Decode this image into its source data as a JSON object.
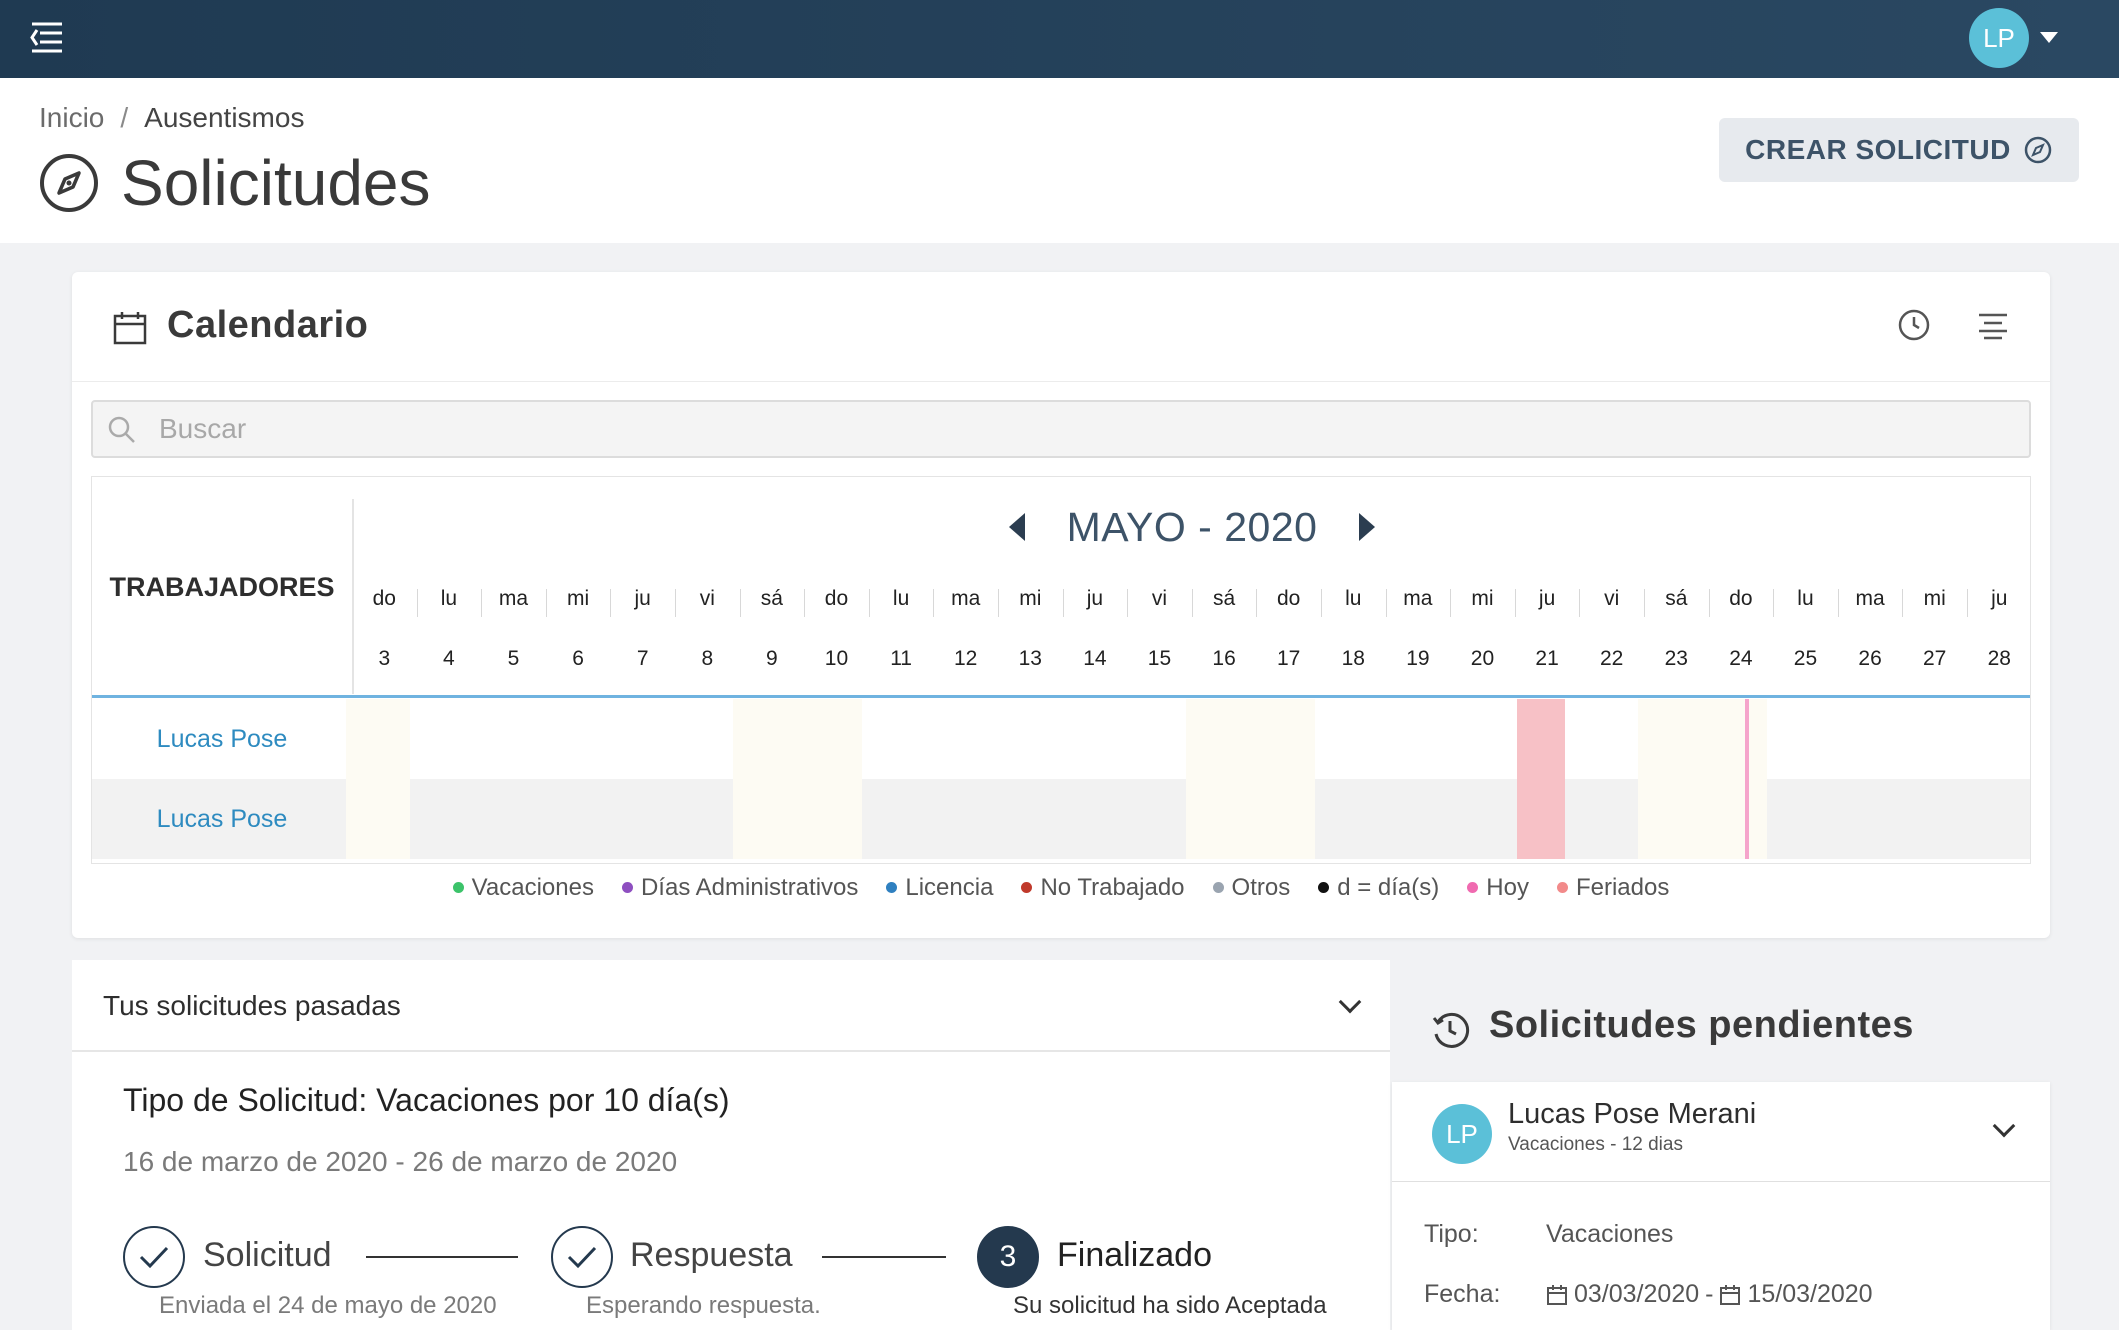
{
  "topbar": {
    "avatar_initials": "LP"
  },
  "breadcrumb": {
    "home": "Inicio",
    "separator": "/",
    "current": "Ausentismos"
  },
  "page": {
    "title": "Solicitudes",
    "create_button": "CREAR SOLICITUD"
  },
  "calendar": {
    "title": "Calendario",
    "search_placeholder": "Buscar",
    "workers_header": "TRABAJADORES",
    "month_label": "MAYO - 2020",
    "days": [
      {
        "name": "do",
        "num": "3"
      },
      {
        "name": "lu",
        "num": "4"
      },
      {
        "name": "ma",
        "num": "5"
      },
      {
        "name": "mi",
        "num": "6"
      },
      {
        "name": "ju",
        "num": "7"
      },
      {
        "name": "vi",
        "num": "8"
      },
      {
        "name": "sá",
        "num": "9"
      },
      {
        "name": "do",
        "num": "10"
      },
      {
        "name": "lu",
        "num": "11"
      },
      {
        "name": "ma",
        "num": "12"
      },
      {
        "name": "mi",
        "num": "13"
      },
      {
        "name": "ju",
        "num": "14"
      },
      {
        "name": "vi",
        "num": "15"
      },
      {
        "name": "sá",
        "num": "16"
      },
      {
        "name": "do",
        "num": "17"
      },
      {
        "name": "lu",
        "num": "18"
      },
      {
        "name": "ma",
        "num": "19"
      },
      {
        "name": "mi",
        "num": "20"
      },
      {
        "name": "ju",
        "num": "21"
      },
      {
        "name": "vi",
        "num": "22"
      },
      {
        "name": "sá",
        "num": "23"
      },
      {
        "name": "do",
        "num": "24"
      },
      {
        "name": "lu",
        "num": "25"
      },
      {
        "name": "ma",
        "num": "26"
      },
      {
        "name": "mi",
        "num": "27"
      },
      {
        "name": "ju",
        "num": "28"
      }
    ],
    "rows": [
      {
        "name": "Lucas Pose"
      },
      {
        "name": "Lucas Pose"
      }
    ],
    "legend": [
      {
        "label": "Vacaciones",
        "color": "#3cc36a"
      },
      {
        "label": "Días Administrativos",
        "color": "#8e4fc0"
      },
      {
        "label": "Licencia",
        "color": "#2f80c0"
      },
      {
        "label": "No Trabajado",
        "color": "#c0392b"
      },
      {
        "label": "Otros",
        "color": "#9aa4b0"
      },
      {
        "label": "d = día(s)",
        "color": "#111111"
      },
      {
        "label": "Hoy",
        "color": "#f06ab0"
      },
      {
        "label": "Feriados",
        "color": "#f28a8a"
      }
    ],
    "colors": {
      "weekend": "#fdfbf3",
      "holiday": "#f7c1c6",
      "today": "#f06ab0"
    }
  },
  "past": {
    "title": "Tus solicitudes pasadas",
    "request_title": "Tipo de Solicitud: Vacaciones por 10 día(s)",
    "dates": "16 de marzo de 2020 - 26 de marzo de 2020",
    "steps": [
      {
        "label": "Solicitud",
        "sub": "Enviada el 24 de mayo de 2020"
      },
      {
        "label": "Respuesta",
        "sub": "Esperando respuesta."
      },
      {
        "number": "3",
        "label": "Finalizado",
        "sub": "Su solicitud ha sido Aceptada"
      }
    ]
  },
  "pending": {
    "title": "Solicitudes pendientes",
    "card": {
      "initials": "LP",
      "name": "Lucas Pose Merani",
      "subtitle": "Vacaciones - 12 dias",
      "tipo_key": "Tipo:",
      "tipo_val": "Vacaciones",
      "fecha_key": "Fecha:",
      "fecha_from": "03/03/2020",
      "fecha_sep": "-",
      "fecha_to": "15/03/2020"
    }
  }
}
